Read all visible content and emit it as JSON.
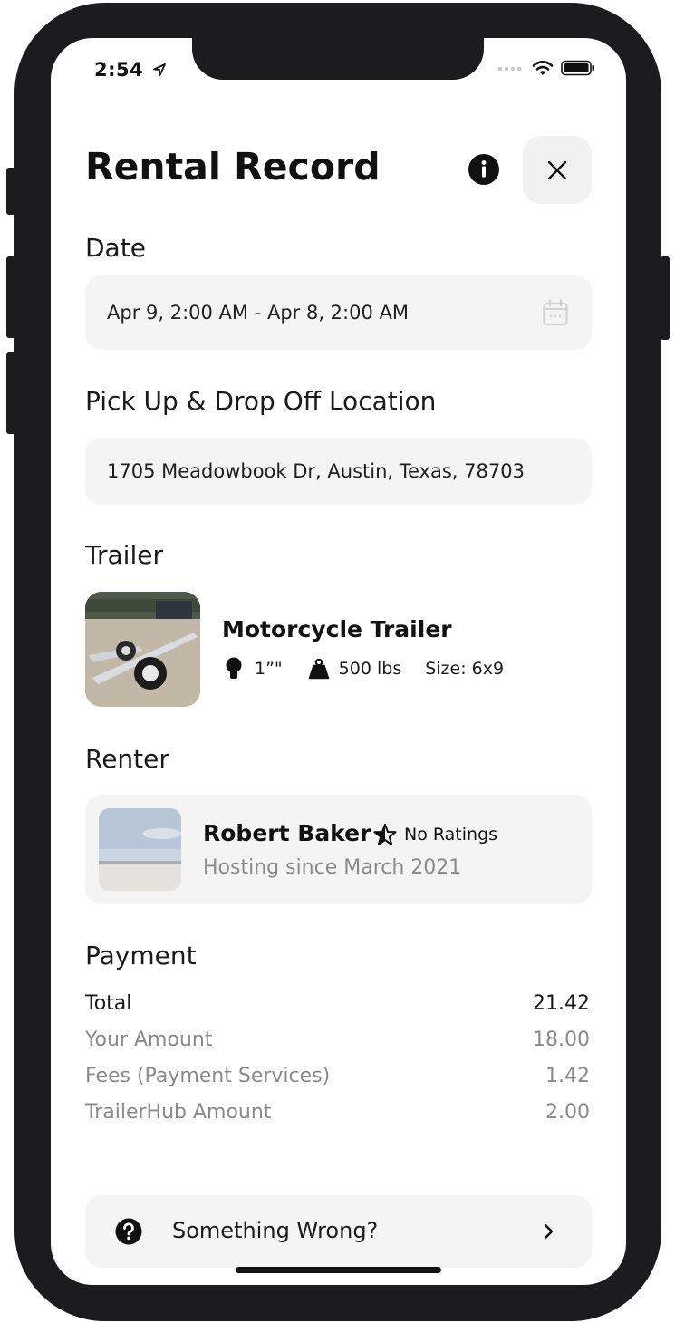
{
  "status_bar": {
    "time": "2:54"
  },
  "header": {
    "title": "Rental Record"
  },
  "date": {
    "label": "Date",
    "value": "Apr 9, 2:00 AM - Apr 8, 2:00 AM"
  },
  "location": {
    "label": "Pick Up & Drop Off Location",
    "value": "1705 Meadowbook Dr, Austin, Texas, 78703"
  },
  "trailer": {
    "label": "Trailer",
    "name": "Motorcycle Trailer",
    "hitch": "1”\"",
    "weight": "500 lbs",
    "size": "Size: 6x9"
  },
  "renter": {
    "label": "Renter",
    "name": "Robert Baker",
    "rating": "No Ratings",
    "hosting": "Hosting since March 2021"
  },
  "payment": {
    "label": "Payment",
    "rows": [
      {
        "label": "Total",
        "value": "21.42"
      },
      {
        "label": "Your Amount",
        "value": "18.00"
      },
      {
        "label": "Fees (Payment Services)",
        "value": "1.42"
      },
      {
        "label": "TrailerHub Amount",
        "value": "2.00"
      }
    ]
  },
  "help": {
    "label": "Something Wrong?"
  },
  "icons": [
    "location-arrow-icon",
    "cellular-icon",
    "wifi-icon",
    "battery-icon",
    "info-icon",
    "close-icon",
    "calendar-icon",
    "hitch-ball-icon",
    "weight-icon",
    "star-icon",
    "question-icon",
    "chevron-right-icon"
  ],
  "colors": {
    "frame": "#1c1c1e",
    "field_bg": "#f4f4f4",
    "muted_text": "#8a8a8a",
    "text": "#111111"
  }
}
